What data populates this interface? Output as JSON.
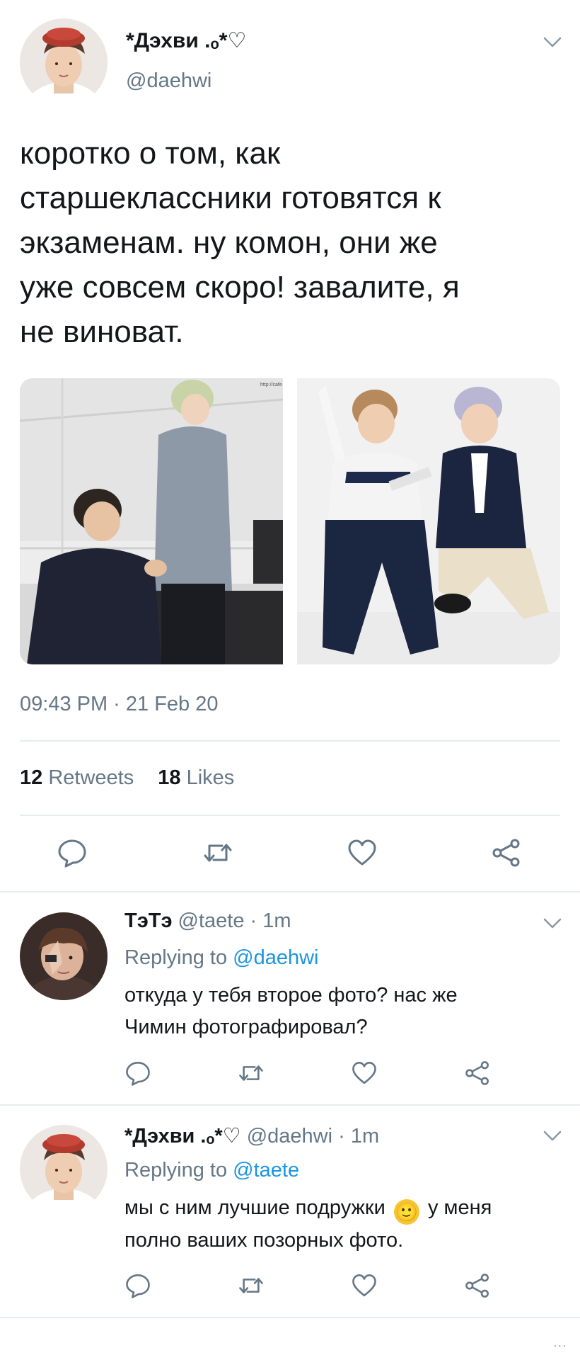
{
  "main_tweet": {
    "author": {
      "display_name": "*Дэхви .ₒ*♡",
      "handle": "@daehwi"
    },
    "text_lines": [
      "коротко о том, как",
      "старшеклассники готовятся к",
      "экзаменам. ну комон, они же",
      "уже совсем скоро! завалите, я",
      "не виноват."
    ],
    "photo1_watermark": "http://cafe",
    "timestamp": "09:43 PM · 21 Feb 20",
    "stats": {
      "retweets_count": "12",
      "retweets_label": "Retweets",
      "likes_count": "18",
      "likes_label": "Likes"
    },
    "actions": [
      "reply-icon",
      "retweet-icon",
      "like-icon",
      "share-icon"
    ]
  },
  "replies": [
    {
      "display_name": "ТэТэ",
      "handle_time": "@taete · 1m",
      "replying_prefix": "Replying to",
      "replying_to": "@daehwi",
      "text_lines": [
        "откуда у тебя второе фото? нас же",
        "Чимин фотографировал?"
      ]
    },
    {
      "display_name": "*Дэхви .ₒ*♡",
      "handle_time": "@daehwi · 1m",
      "replying_prefix": "Replying to",
      "replying_to": "@taete",
      "text_line1_before": "мы с ним лучшие подружки",
      "emoji": "🙂",
      "text_line1_after": "у меня",
      "text_line2": "полно ваших позорных фото."
    }
  ],
  "footer": {
    "ellipsis": "..."
  },
  "colors": {
    "text": "#14171a",
    "muted": "#657786",
    "link": "#1b95e0",
    "divider": "#e6ecf0"
  }
}
